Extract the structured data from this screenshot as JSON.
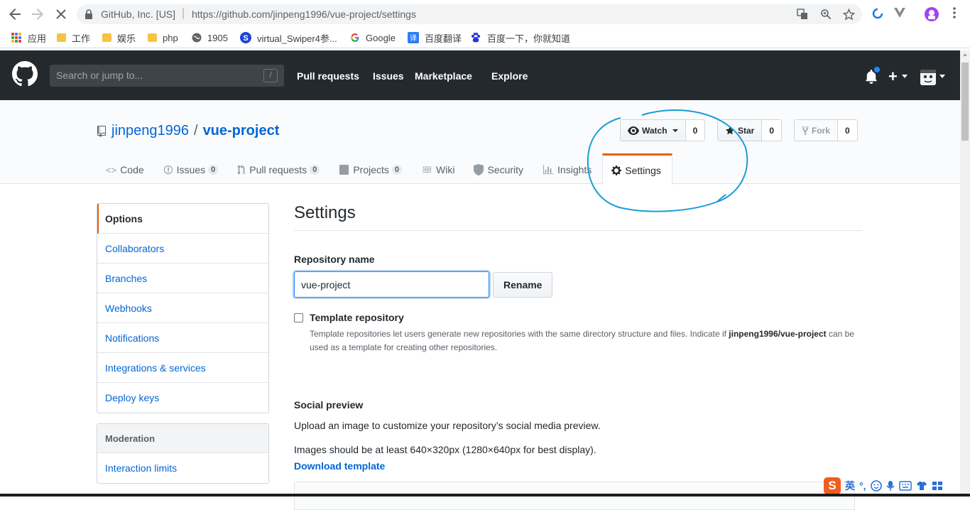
{
  "browser": {
    "origin": "GitHub, Inc. [US]",
    "url": "https://github.com/jinpeng1996/vue-project/settings",
    "bookmarks": [
      {
        "label": "应用",
        "icon": "apps-icon"
      },
      {
        "label": "工作",
        "icon": "folder-icon"
      },
      {
        "label": "娱乐",
        "icon": "folder-icon"
      },
      {
        "label": "php",
        "icon": "folder-icon"
      },
      {
        "label": "1905",
        "icon": "globe-icon"
      },
      {
        "label": "virtual_Swiper4参...",
        "icon": "swiper-icon"
      },
      {
        "label": "Google",
        "icon": "google-icon"
      },
      {
        "label": "百度翻译",
        "icon": "baidu-translate-icon"
      },
      {
        "label": "百度一下，你就知道",
        "icon": "baidu-icon"
      }
    ]
  },
  "header": {
    "search_placeholder": "Search or jump to...",
    "search_key": "/",
    "nav": [
      "Pull requests",
      "Issues",
      "Marketplace",
      "Explore"
    ],
    "plus": "+"
  },
  "repo": {
    "owner": "jinpeng1996",
    "separator": "/",
    "name": "vue-project",
    "watch": {
      "label": "Watch",
      "count": "0"
    },
    "star": {
      "label": "Star",
      "count": "0"
    },
    "fork": {
      "label": "Fork",
      "count": "0"
    },
    "tabs": [
      {
        "label": "Code",
        "icon": "<>"
      },
      {
        "label": "Issues",
        "counter": "0"
      },
      {
        "label": "Pull requests",
        "counter": "0"
      },
      {
        "label": "Projects",
        "counter": "0"
      },
      {
        "label": "Wiki"
      },
      {
        "label": "Security"
      },
      {
        "label": "Insights"
      },
      {
        "label": "Settings",
        "selected": true
      }
    ]
  },
  "sidebar": {
    "items": [
      "Options",
      "Collaborators",
      "Branches",
      "Webhooks",
      "Notifications",
      "Integrations & services",
      "Deploy keys"
    ],
    "moderation_heading": "Moderation",
    "moderation_items": [
      "Interaction limits"
    ]
  },
  "settings": {
    "title": "Settings",
    "repo_name_label": "Repository name",
    "repo_name_value": "vue-project",
    "rename_button": "Rename",
    "template_label": "Template repository",
    "template_note_1": "Template repositories let users generate new repositories with the same directory structure and files. Indicate if ",
    "template_note_repo": "jinpeng1996/vue-project",
    "template_note_2": " can be used as a template for creating other repositories.",
    "social_heading": "Social preview",
    "social_text": "Upload an image to customize your repository’s social media preview.",
    "image_size_text": "Images should be at least 640×320px (1280×640px for best display).",
    "download_template": "Download template"
  },
  "ime": {
    "logo": "S",
    "mode": "英"
  },
  "colors": {
    "accent": "#e36209",
    "link": "#0366d6",
    "header_bg": "#24292e",
    "annotation": "#1a9bd7"
  }
}
